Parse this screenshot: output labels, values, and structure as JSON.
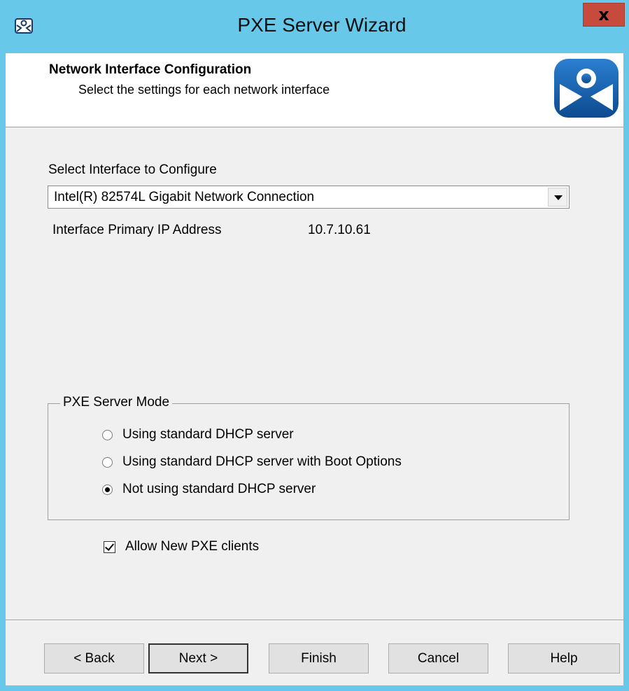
{
  "window": {
    "title": "PXE Server Wizard",
    "close_label": "x",
    "app_icon": "thinmanager-icon"
  },
  "header": {
    "title": "Network Interface Configuration",
    "subtitle": "Select the settings for each network interface",
    "logo": "thinmanager-logo"
  },
  "interface": {
    "select_label": "Select Interface to Configure",
    "selected": "Intel(R) 82574L Gigabit Network Connection",
    "ip_label": "Interface Primary IP Address",
    "ip_value": "10.7.10.61"
  },
  "pxe_mode": {
    "legend": "PXE Server Mode",
    "options": [
      {
        "label": "Using standard DHCP server",
        "checked": false
      },
      {
        "label": "Using standard DHCP server with Boot Options",
        "checked": false
      },
      {
        "label": "Not using standard DHCP server",
        "checked": true
      }
    ]
  },
  "allow_new": {
    "label": "Allow New PXE clients",
    "checked": true
  },
  "buttons": {
    "back": "< Back",
    "next": "Next >",
    "finish": "Finish",
    "cancel": "Cancel",
    "help": "Help"
  },
  "colors": {
    "titlebar": "#67c8ea",
    "close": "#c74b3c",
    "logo_blue": "#1a63b0"
  }
}
